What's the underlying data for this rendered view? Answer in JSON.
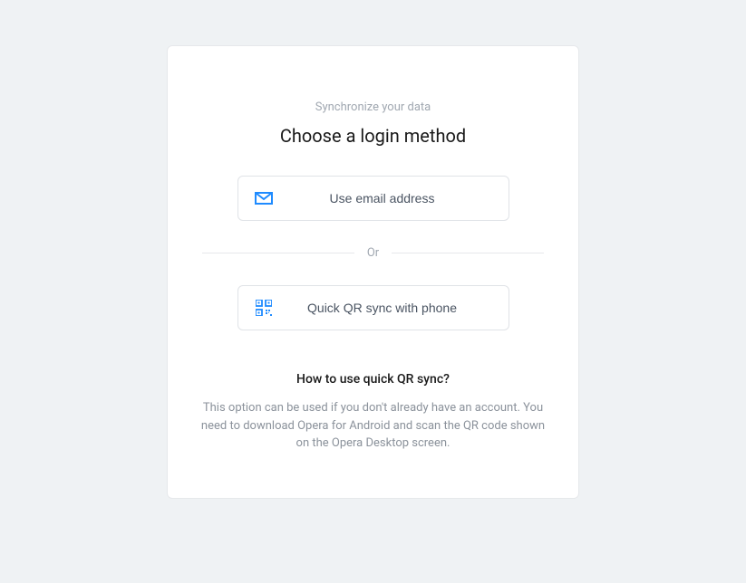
{
  "header": {
    "subtitle": "Synchronize your data",
    "title": "Choose a login method"
  },
  "options": {
    "email_label": "Use email address",
    "qr_label": "Quick QR sync with phone"
  },
  "divider_label": "Or",
  "help": {
    "title": "How to use quick QR sync?",
    "text": "This option can be used if you don't already have an account. You need to download Opera for Android and scan the QR code shown on the Opera Desktop screen."
  },
  "colors": {
    "accent": "#1f8bff"
  }
}
